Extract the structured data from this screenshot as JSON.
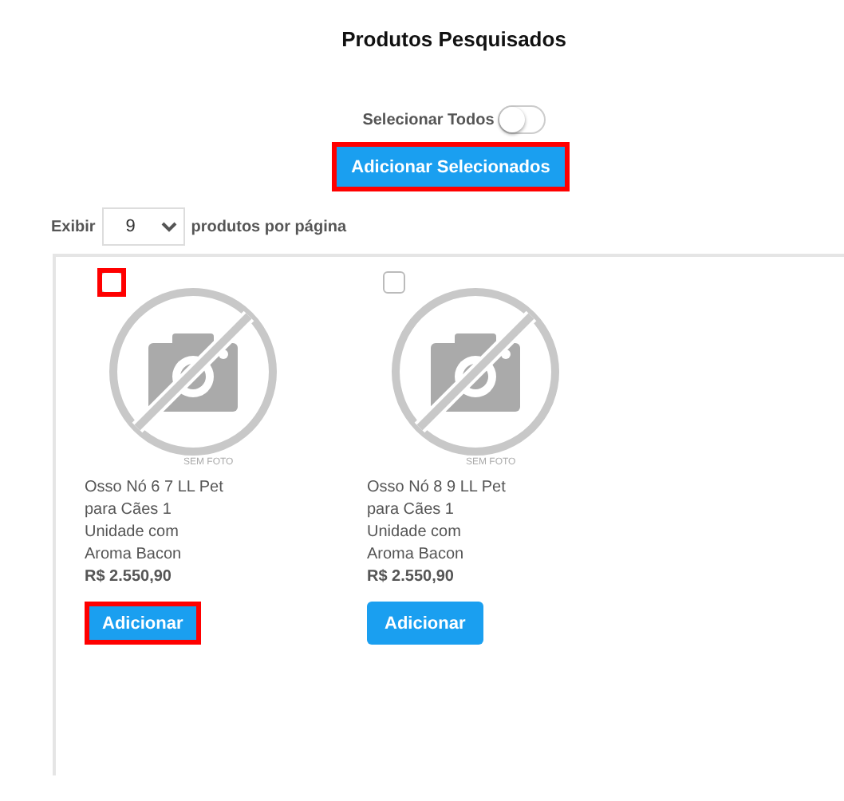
{
  "title": "Produtos Pesquisados",
  "select_all": {
    "label": "Selecionar Todos",
    "on": false
  },
  "add_selected_button": {
    "label": "Adicionar Selecionados",
    "highlighted": true
  },
  "per_page": {
    "prefix": "Exibir",
    "value": "9",
    "suffix": "produtos por página"
  },
  "products": [
    {
      "checked": false,
      "checkbox_highlighted": true,
      "image_caption": "SEM FOTO",
      "name": "Osso Nó 6 7 LL Pet para Cães 1 Unidade com Aroma Bacon",
      "price": "R$ 2.550,90",
      "button": "Adicionar",
      "button_highlighted": true
    },
    {
      "checked": false,
      "checkbox_highlighted": false,
      "image_caption": "SEM FOTO",
      "name": "Osso Nó 8 9 LL Pet para Cães 1 Unidade com Aroma Bacon",
      "price": "R$ 2.550,90",
      "button": "Adicionar",
      "button_highlighted": false
    }
  ]
}
